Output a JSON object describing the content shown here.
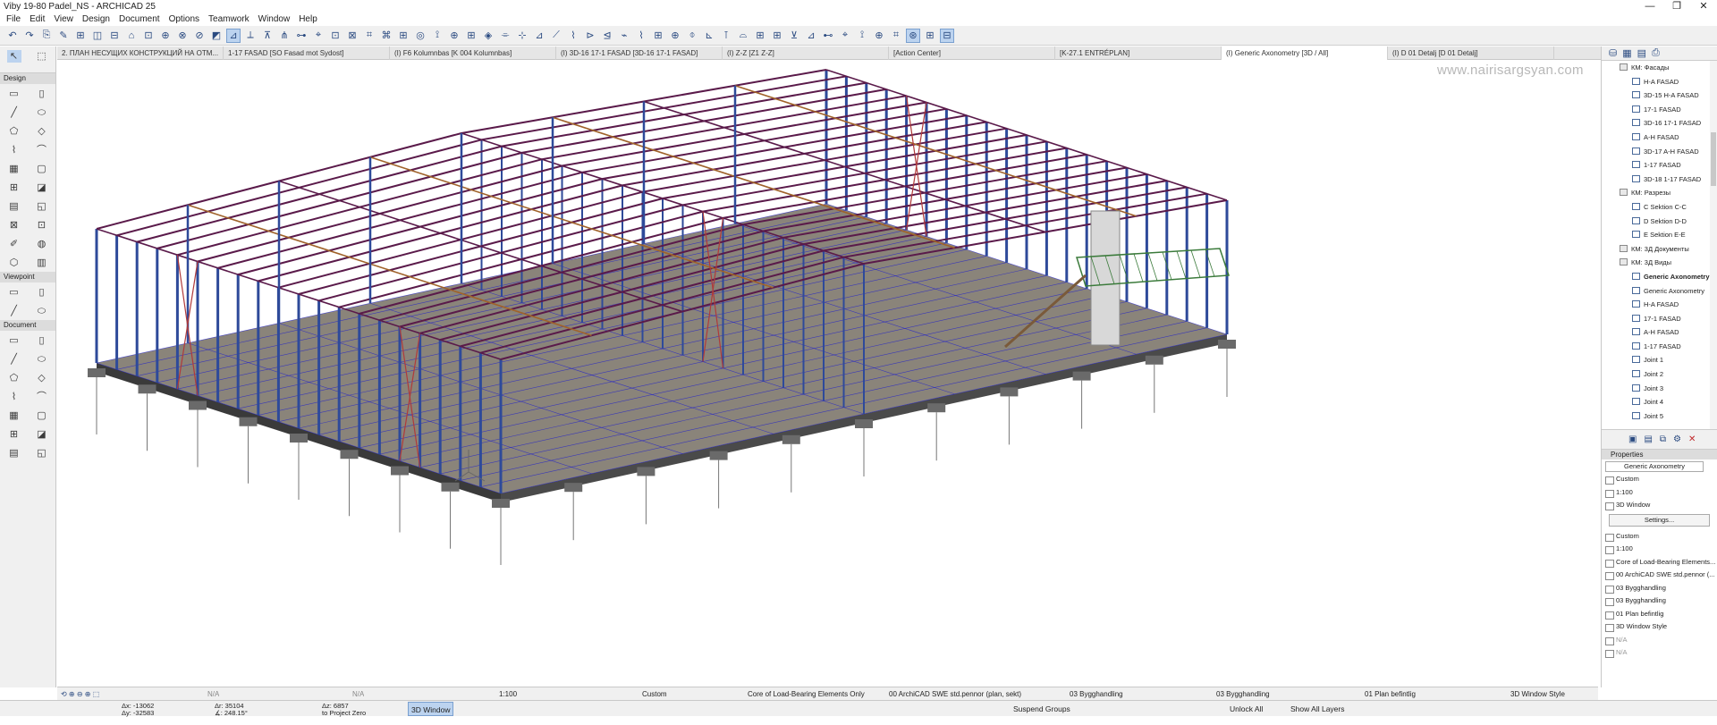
{
  "title": "Viby 19-80 Padel_NS - ARCHICAD 25",
  "window_controls": [
    "—",
    "❐",
    "✕"
  ],
  "menu": [
    "File",
    "Edit",
    "View",
    "Design",
    "Document",
    "Options",
    "Teamwork",
    "Window",
    "Help"
  ],
  "tabs": [
    "2. ПЛАН НЕСУЩИХ КОНСТРУКЦИЙ НА ОТМ...",
    "1-17 FASAD [SO Fasad mot Sydost]",
    "(I) F6 Kolumnbas [K 004 Kolumnbas]",
    "(I) 3D-16 17-1 FASAD [3D-16 17-1 FASAD]",
    "(I) Z-Z [Z1 Z-Z]",
    "[Action Center]",
    "[K-27.1 ENTRÉPLAN]",
    "(I) Generic Axonometry [3D / All]",
    "(I) D 01 Detalj [D 01 Detalj]"
  ],
  "active_tab_index": 7,
  "watermark": "www.nairisargsyan.com",
  "toolbox": {
    "design_label": "Design",
    "viewpoint_label": "Viewpoint",
    "document_label": "Document"
  },
  "navigator": [
    {
      "label": "КМ: Фасады",
      "folder": true,
      "indent": 1
    },
    {
      "label": "H-A FASAD",
      "indent": 2
    },
    {
      "label": "3D-15 H-A FASAD",
      "indent": 2
    },
    {
      "label": "17-1  FASAD",
      "indent": 2
    },
    {
      "label": "3D-16 17-1 FASAD",
      "indent": 2
    },
    {
      "label": "A-H FASAD",
      "indent": 2
    },
    {
      "label": "3D-17 A-H FASAD",
      "indent": 2
    },
    {
      "label": "1-17 FASAD",
      "indent": 2
    },
    {
      "label": "3D-18 1-17 FASAD",
      "indent": 2
    },
    {
      "label": "КМ: Разрезы",
      "folder": true,
      "indent": 1
    },
    {
      "label": "C Sektion C-C",
      "indent": 2
    },
    {
      "label": "D Sektion D-D",
      "indent": 2
    },
    {
      "label": "E Sektion E-E",
      "indent": 2
    },
    {
      "label": "КМ: 3Д Документы",
      "folder": true,
      "indent": 1
    },
    {
      "label": "КМ: 3Д Виды",
      "folder": true,
      "indent": 1
    },
    {
      "label": "Generic Axonometry",
      "indent": 2,
      "bold": true
    },
    {
      "label": "Generic Axonometry",
      "indent": 2
    },
    {
      "label": "H-A FASAD",
      "indent": 2
    },
    {
      "label": "17-1 FASAD",
      "indent": 2
    },
    {
      "label": "A-H FASAD",
      "indent": 2
    },
    {
      "label": "1-17 FASAD",
      "indent": 2
    },
    {
      "label": "Joint 1",
      "indent": 2
    },
    {
      "label": "Joint 2",
      "indent": 2
    },
    {
      "label": "Joint 3",
      "indent": 2
    },
    {
      "label": "Joint 4",
      "indent": 2
    },
    {
      "label": "Joint 5",
      "indent": 2
    }
  ],
  "properties": {
    "header": "Properties",
    "name": "Generic Axonometry",
    "custom": "Custom",
    "scale": "1:100",
    "window_type": "3D Window",
    "settings_button": "Settings...",
    "list": [
      "Custom",
      "1:100",
      "Core of Load-Bearing Elements...",
      "00 ArchiCAD SWE std.pennor (...",
      "03 Bygghandling",
      "03 Bygghandling",
      "01 Plan befintlig",
      "3D Window Style",
      "N/A",
      "N/A"
    ]
  },
  "status_bar_1": {
    "na1": "N/A",
    "na2": "N/A",
    "scale": "1:100",
    "custom": "Custom",
    "model_view": "Core of Load-Bearing Elements Only",
    "pen_set": "00 ArchiCAD SWE std.pennor (plan, sekt)",
    "layer1": "03 Bygghandling",
    "layer2": "03 Bygghandling",
    "renovation": "01 Plan befintlig",
    "style": "3D Window Style"
  },
  "status_bar_2": {
    "ax": "Δx: -13062",
    "ay": "Δy: -32583",
    "ar": "Δr: 35104",
    "aa": "∡: 248.15°",
    "az": "Δz: 6857",
    "zref": "to Project Zero",
    "view_3d": "3D Window",
    "suspend_groups": "Suspend Groups",
    "unlock_all": "Unlock All",
    "show_all_layers": "Show All Layers"
  },
  "colors": {
    "columns": "#2e4a9a",
    "beams": "#5a1a4a",
    "purlins": "#a0622a",
    "bracing": "#b03a3a",
    "slab_top": "#8a847a",
    "grid": "#1a1ad0",
    "footing": "#6a6a6a"
  }
}
